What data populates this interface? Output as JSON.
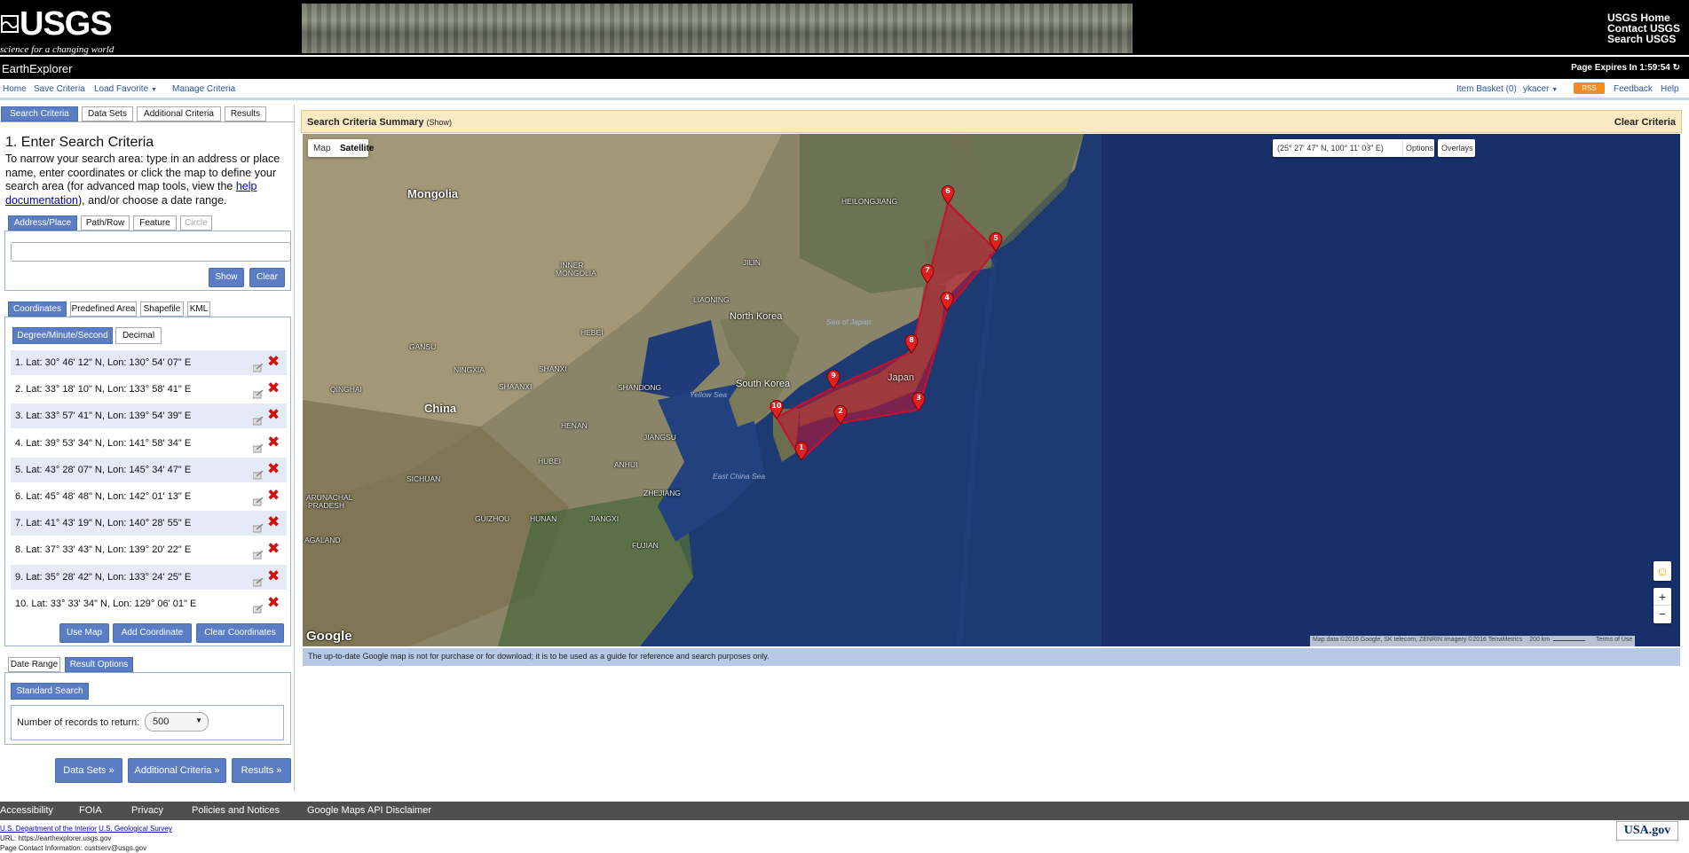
{
  "header": {
    "logo": "USGS",
    "tagline": "science for a changing world",
    "links": [
      "USGS Home",
      "Contact USGS",
      "Search USGS"
    ]
  },
  "titlebar": {
    "app_title": "EarthExplorer",
    "page_expires": "Page Expires In 1:59:54"
  },
  "menu": {
    "left": [
      "Home",
      "Save Criteria",
      "Load Favorite",
      "Manage Criteria"
    ],
    "right": [
      "Item Basket (0)",
      "ykacer",
      "RSS",
      "Feedback",
      "Help"
    ]
  },
  "left": {
    "tabs": [
      "Search Criteria",
      "Data Sets",
      "Additional Criteria",
      "Results"
    ],
    "step_title": "1. Enter Search Criteria",
    "step_desc_1": "To narrow your search area: type in an address or place name, enter coordinates or click the map to define your search area (for advanced map tools, view the ",
    "step_desc_link": "help documentation",
    "step_desc_2": "), and/or choose a date range.",
    "addr_tabs": [
      "Address/Place",
      "Path/Row",
      "Feature",
      "Circle"
    ],
    "address_value": "",
    "show_btn": "Show",
    "clear_btn": "Clear",
    "coord_tabs": [
      "Coordinates",
      "Predefined Area",
      "Shapefile",
      "KML"
    ],
    "format_tabs": [
      "Degree/Minute/Second",
      "Decimal"
    ],
    "coordinates": [
      "1.  Lat: 30° 46' 12\" N, Lon: 130° 54' 07\" E",
      "2.  Lat: 33° 18' 10\" N, Lon: 133° 58' 41\" E",
      "3.  Lat: 33° 57' 41\" N, Lon: 139° 54' 39\" E",
      "4.  Lat: 39° 53' 34\" N, Lon: 141° 58' 34\" E",
      "5.  Lat: 43° 28' 07\" N, Lon: 145° 34' 47\" E",
      "6.  Lat: 45° 48' 48\" N, Lon: 142° 01' 13\" E",
      "7.  Lat: 41° 43' 19\" N, Lon: 140° 28' 55\" E",
      "8.  Lat: 37° 33' 43\" N, Lon: 139° 20' 22\" E",
      "9.  Lat: 35° 28' 42\" N, Lon: 133° 24' 25\" E",
      "10.  Lat: 33° 33' 34\" N, Lon: 129° 06' 01\" E"
    ],
    "use_map_btn": "Use Map",
    "add_coord_btn": "Add Coordinate",
    "clear_coords_btn": "Clear Coordinates",
    "date_tabs": [
      "Date Range",
      "Result Options"
    ],
    "standard_search": "Standard Search",
    "records_label": "Number of records to return:",
    "records_value": "500",
    "nav_buttons": [
      "Data Sets »",
      "Additional Criteria »",
      "Results »"
    ]
  },
  "map": {
    "summary_title": "Search Criteria Summary",
    "summary_show": "(Show)",
    "clear_criteria": "Clear Criteria",
    "type_map": "Map",
    "type_satellite": "Satellite",
    "coord_readout": "(25° 27' 47\" N, 100° 11' 03\" E)",
    "options": "Options",
    "overlays": "Overlays",
    "labels": {
      "mongolia": "Mongolia",
      "heilongjiang": "HEILONGJIANG",
      "inner_mongolia_1": "INNER",
      "inner_mongolia_2": "MONGOLIA",
      "jilin": "JILIN",
      "liaoning": "LIAONING",
      "north_korea": "North Korea",
      "sea_of_japan": "Sea of Japan",
      "gansu": "GANSU",
      "hebei": "HEBEI",
      "ningxia": "NINGXIA",
      "shanxi": "SHANXI",
      "shaanxi": "SHAANXI",
      "shandong": "SHANDONG",
      "south_korea": "South Korea",
      "qinghai": "QINGHAI",
      "china": "China",
      "yellow_sea": "Yellow Sea",
      "japan": "Japan",
      "henan": "HENAN",
      "jiangsu": "JIANGSU",
      "hubei": "HUBEI",
      "anhui": "ANHUI",
      "sichuan": "SICHUAN",
      "east_china_sea": "East China Sea",
      "zhejiang": "ZHEJIANG",
      "arunachal_1": "ARUNACHAL",
      "arunachal_2": "PRADESH",
      "guizhou": "GUIZHOU",
      "hunan": "HUNAN",
      "jiangxi": "JIANGXI",
      "fujian": "FUJIAN",
      "nagaland": "AGALAND"
    },
    "google": "Google",
    "attribution": "Map data ©2016 Google, SK telecom, ZENRIN Imagery ©2016 TerraMetrics",
    "scale": "200 km",
    "terms": "Terms of Use",
    "zoom_in": "+",
    "zoom_out": "−",
    "marker_labels": [
      "1",
      "2",
      "3",
      "4",
      "5",
      "6",
      "7",
      "8",
      "9",
      "10"
    ],
    "disclaimer": "The up-to-date Google map is not for purchase or for download; it is to be used as a guide for reference and search purposes only."
  },
  "footer": {
    "links": [
      "Accessibility",
      "FOIA",
      "Privacy",
      "Policies and Notices",
      "Google Maps API Disclaimer"
    ],
    "doi": "U.S. Department of the Interior",
    "usgs": "U.S. Geological Survey",
    "url": "URL: https://earthexplorer.usgs.gov",
    "contact": "Page Contact Information: custserv@usgs.gov",
    "usagov": "USA.gov"
  },
  "colors": {
    "accent": "#5b7dc3",
    "polygon": "#c8102e",
    "summary_bg": "#fbe9c3",
    "ocean": "#1b3466"
  }
}
